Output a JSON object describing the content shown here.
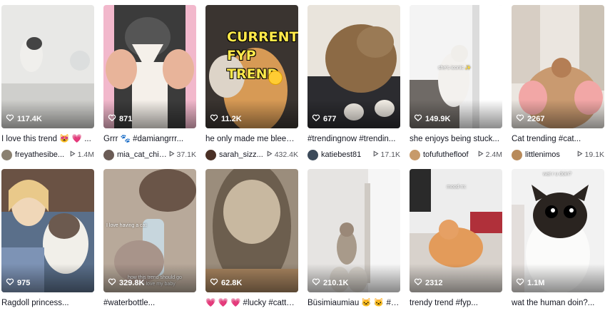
{
  "videos": [
    {
      "likes": "117.4K",
      "caption": "I love this trend 😻 💗 ...",
      "author": "freyathesibe...",
      "views": "1.4M",
      "colors": {
        "bg1": "#e8e8e6",
        "bg2": "#cfcfcc",
        "accent": "#777",
        "avatar": "#8a8070"
      }
    },
    {
      "likes": "871",
      "caption": "Grrr 🐾 #damiangrrr...",
      "author": "mia_cat_chic...",
      "views": "37.1K",
      "colors": {
        "bg1": "#f2b8cc",
        "bg2": "#3b3b3b",
        "accent": "#f5f0ea",
        "avatar": "#6a5b55"
      }
    },
    {
      "likes": "11.2K",
      "caption": "he only made me bleed ...",
      "author": "sarah_sizz...",
      "views": "432.4K",
      "overlay": [
        "CURRENT",
        "FYP",
        "TREND"
      ],
      "colors": {
        "bg1": "#3a3430",
        "bg2": "#d79a55",
        "accent": "#c8844a",
        "avatar": "#4a3025"
      }
    },
    {
      "likes": "677",
      "caption": "#trendingnow #trendin...",
      "author": "katiebest81",
      "views": "17.1K",
      "colors": {
        "bg1": "#e9e4dc",
        "bg2": "#8c6a45",
        "accent": "#5a4a3a",
        "avatar": "#3c4a5a"
      }
    },
    {
      "likes": "149.9K",
      "caption": "she enjoys being stuck...",
      "author": "tofufuthefloof",
      "views": "2.4M",
      "overlay_small": "she's iconic ✨",
      "colors": {
        "bg1": "#f4f4f4",
        "bg2": "#d9d6d0",
        "accent": "#777",
        "avatar": "#c79a6a"
      }
    },
    {
      "likes": "2267",
      "caption": "Cat trending #cat...",
      "author": "littlenimos",
      "views": "19.1K",
      "colors": {
        "bg1": "#ebe6e0",
        "bg2": "#c99a70",
        "accent": "#f2a7a6",
        "avatar": "#b88a5a"
      }
    },
    {
      "likes": "975",
      "caption": "Ragdoll princess...",
      "author": "",
      "views": "",
      "colors": {
        "bg1": "#d9e3ec",
        "bg2": "#5a6f8a",
        "accent": "#f0d7b8",
        "avatar": "#999"
      }
    },
    {
      "likes": "329.8K",
      "caption": "#waterbottle...",
      "author": "",
      "views": "",
      "overlay_small": "I love having a cat",
      "overlay_small2": "how this trend should go",
      "overlay_small3": "i love my baby",
      "colors": {
        "bg1": "#b8a99a",
        "bg2": "#6a5548",
        "accent": "#c7d6dd",
        "avatar": "#999"
      }
    },
    {
      "likes": "62.8K",
      "caption": "💗 💗 💗 #lucky #cattok...",
      "author": "",
      "views": "",
      "colors": {
        "bg1": "#9b8d7c",
        "bg2": "#6c5e4e",
        "accent": "#c8b8a0",
        "avatar": "#999"
      }
    },
    {
      "likes": "210.1K",
      "caption": "Büsimiaumiau 🐱 🐱 #fy...",
      "author": "",
      "views": "",
      "colors": {
        "bg1": "#e6e4e2",
        "bg2": "#bdb8b2",
        "accent": "#a89a8a",
        "avatar": "#999"
      }
    },
    {
      "likes": "2312",
      "caption": "trendy trend #fyp...",
      "author": "",
      "views": "",
      "overlay_small": "mood rn:",
      "colors": {
        "bg1": "#ededed",
        "bg2": "#d8d2cc",
        "accent": "#e39b5a",
        "avatar": "#999"
      }
    },
    {
      "likes": "1.1M",
      "caption": "wat the human doin?...",
      "author": "",
      "views": "",
      "overlay_small": "wat r u doin?",
      "colors": {
        "bg1": "#f2f2f2",
        "bg2": "#e2e2e2",
        "accent": "#2a2420",
        "avatar": "#999"
      }
    }
  ],
  "icons": {
    "likes": "heart-outline-icon",
    "views": "play-outline-icon"
  }
}
